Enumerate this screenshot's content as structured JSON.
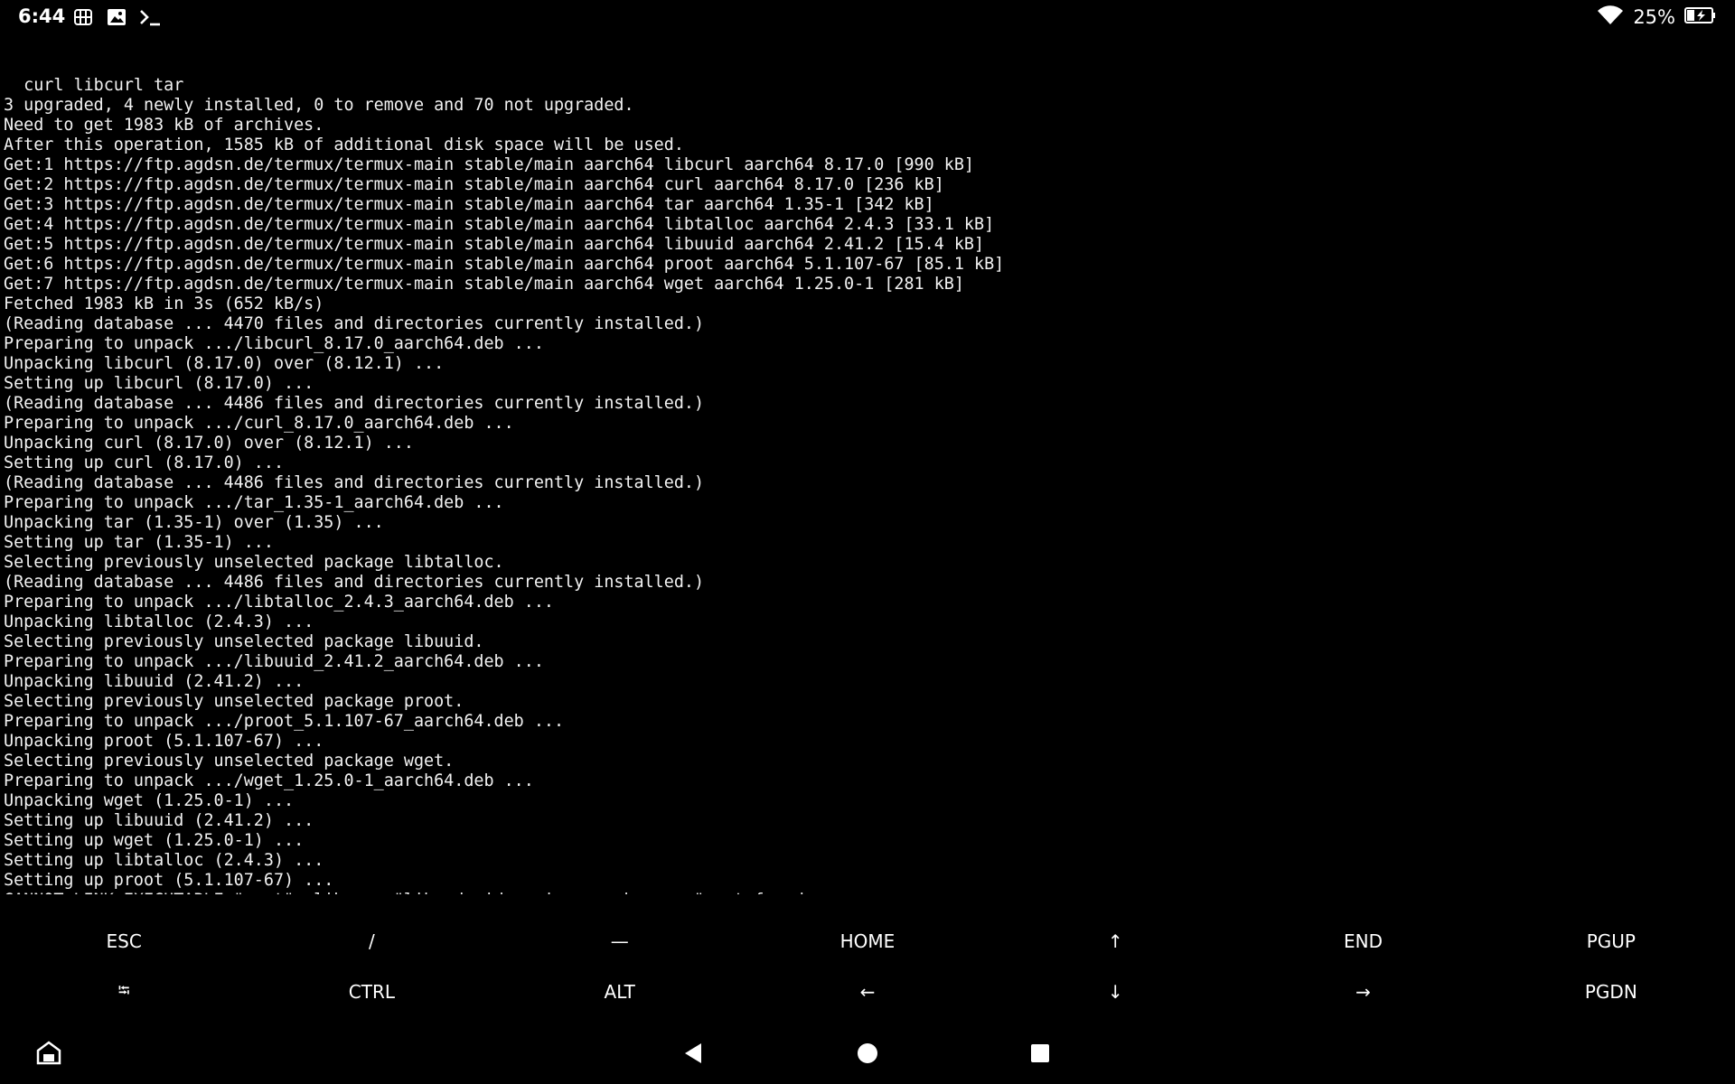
{
  "status_bar": {
    "time": "6:44",
    "left_icons": [
      "vpn-icon",
      "gallery-icon",
      "terminal-icon"
    ],
    "battery_percent": "25%",
    "wifi_icon": "wifi-icon",
    "battery_icon": "battery-charging-icon"
  },
  "terminal": {
    "lines": [
      "  curl libcurl tar",
      "3 upgraded, 4 newly installed, 0 to remove and 70 not upgraded.",
      "Need to get 1983 kB of archives.",
      "After this operation, 1585 kB of additional disk space will be used.",
      "Get:1 https://ftp.agdsn.de/termux/termux-main stable/main aarch64 libcurl aarch64 8.17.0 [990 kB]",
      "Get:2 https://ftp.agdsn.de/termux/termux-main stable/main aarch64 curl aarch64 8.17.0 [236 kB]",
      "Get:3 https://ftp.agdsn.de/termux/termux-main stable/main aarch64 tar aarch64 1.35-1 [342 kB]",
      "Get:4 https://ftp.agdsn.de/termux/termux-main stable/main aarch64 libtalloc aarch64 2.4.3 [33.1 kB]",
      "Get:5 https://ftp.agdsn.de/termux/termux-main stable/main aarch64 libuuid aarch64 2.41.2 [15.4 kB]",
      "Get:6 https://ftp.agdsn.de/termux/termux-main stable/main aarch64 proot aarch64 5.1.107-67 [85.1 kB]",
      "Get:7 https://ftp.agdsn.de/termux/termux-main stable/main aarch64 wget aarch64 1.25.0-1 [281 kB]",
      "Fetched 1983 kB in 3s (652 kB/s)",
      "(Reading database ... 4470 files and directories currently installed.)",
      "Preparing to unpack .../libcurl_8.17.0_aarch64.deb ...",
      "Unpacking libcurl (8.17.0) over (8.12.1) ...",
      "Setting up libcurl (8.17.0) ...",
      "(Reading database ... 4486 files and directories currently installed.)",
      "Preparing to unpack .../curl_8.17.0_aarch64.deb ...",
      "Unpacking curl (8.17.0) over (8.12.1) ...",
      "Setting up curl (8.17.0) ...",
      "(Reading database ... 4486 files and directories currently installed.)",
      "Preparing to unpack .../tar_1.35-1_aarch64.deb ...",
      "Unpacking tar (1.35-1) over (1.35) ...",
      "Setting up tar (1.35-1) ...",
      "Selecting previously unselected package libtalloc.",
      "(Reading database ... 4486 files and directories currently installed.)",
      "Preparing to unpack .../libtalloc_2.4.3_aarch64.deb ...",
      "Unpacking libtalloc (2.4.3) ...",
      "Selecting previously unselected package libuuid.",
      "Preparing to unpack .../libuuid_2.41.2_aarch64.deb ...",
      "Unpacking libuuid (2.41.2) ...",
      "Selecting previously unselected package proot.",
      "Preparing to unpack .../proot_5.1.107-67_aarch64.deb ...",
      "Unpacking proot (5.1.107-67) ...",
      "Selecting previously unselected package wget.",
      "Preparing to unpack .../wget_1.25.0-1_aarch64.deb ...",
      "Unpacking wget (1.25.0-1) ...",
      "Setting up libuuid (2.41.2) ...",
      "Setting up wget (1.25.0-1) ...",
      "Setting up libtalloc (2.4.3) ...",
      "Setting up proot (5.1.107-67) ...",
      "CANNOT LINK EXECUTABLE \"wget\": library \"libandroid-posix-semaphore.so\" not found"
    ],
    "prompt_tilde": "~",
    "prompt_dollar": "$",
    "prompt_color": "#4caf50"
  },
  "extra_keys": {
    "row1": [
      "ESC",
      "/",
      "—",
      "HOME",
      "↑",
      "END",
      "PGUP"
    ],
    "row2": [
      "⭾",
      "CTRL",
      "ALT",
      "←",
      "↓",
      "→",
      "PGDN"
    ]
  },
  "nav_bar": {
    "keyboard_toggle_icon": "keyboard-toggle-icon",
    "back_icon": "back-triangle-icon",
    "home_icon": "home-circle-icon",
    "recents_icon": "recents-square-icon"
  }
}
